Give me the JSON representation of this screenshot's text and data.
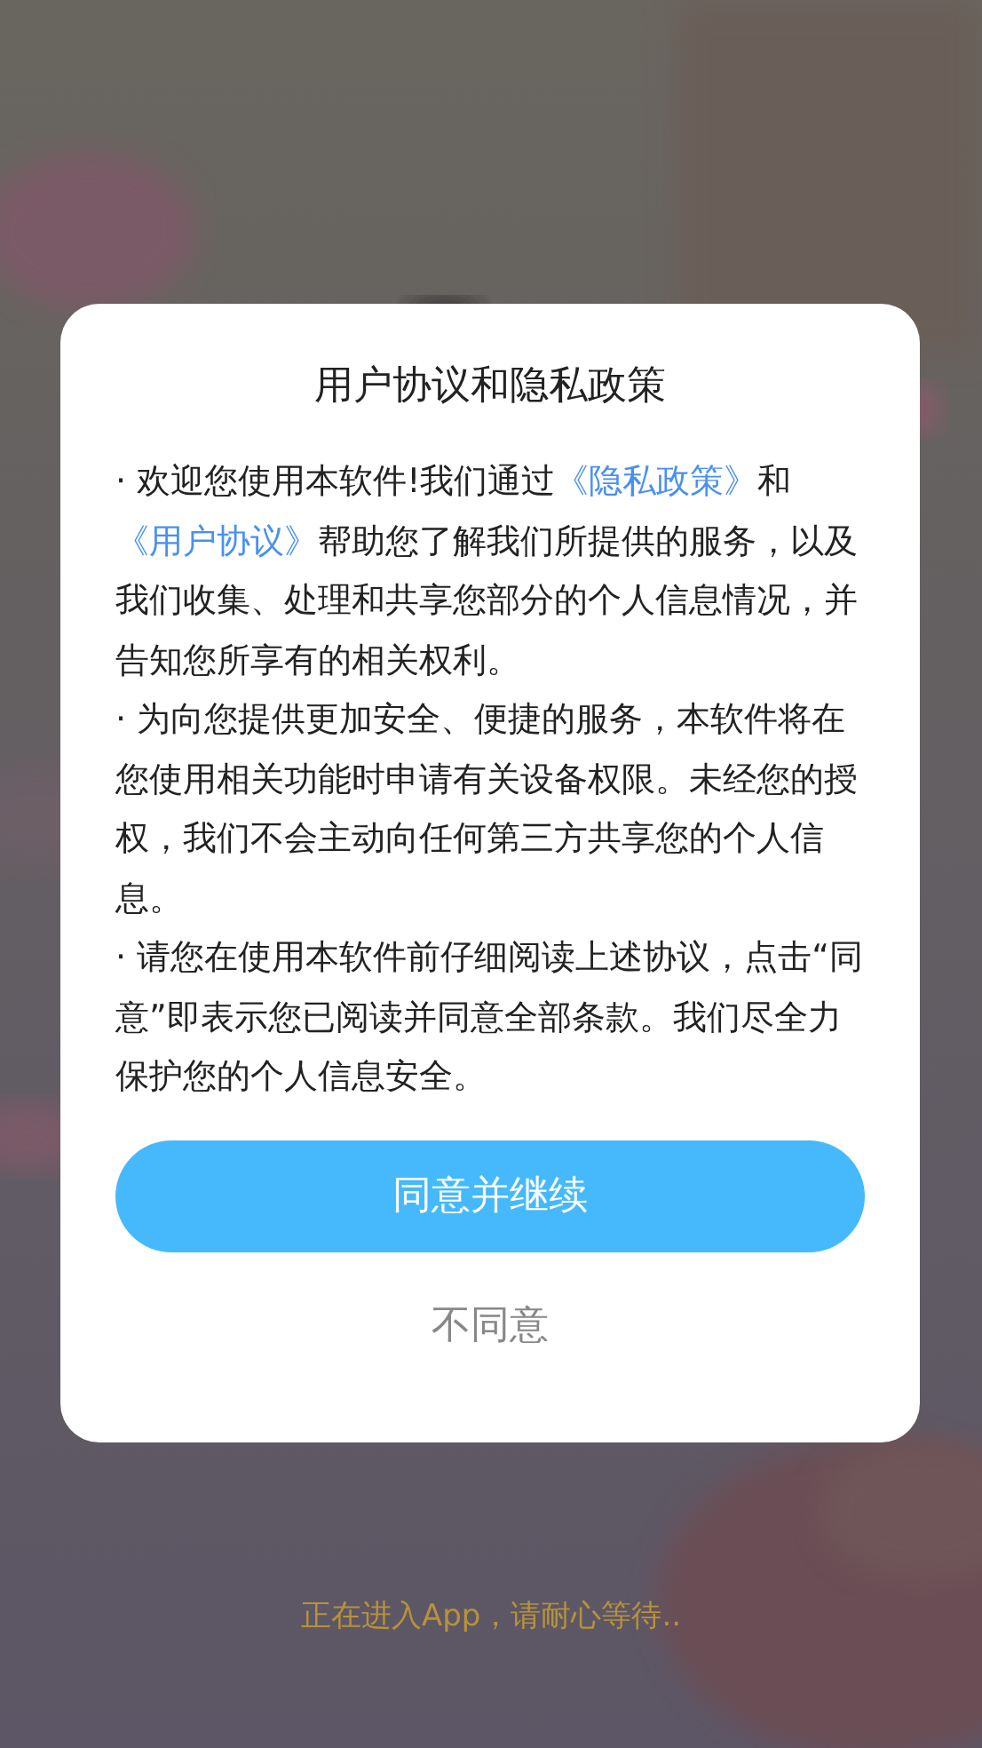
{
  "loading_text": "正在进入App，请耐心等待..",
  "dialog": {
    "title": "用户协议和隐私政策",
    "paragraphs": [
      [
        {
          "kind": "text",
          "text": "· 欢迎您使用本软件!我们通过"
        },
        {
          "kind": "link",
          "text": "《隐私政策》"
        },
        {
          "kind": "text",
          "text": "和"
        },
        {
          "kind": "link",
          "text": "《用户协议》"
        },
        {
          "kind": "text",
          "text": "帮助您了解我们所提供的服务，以及我们收集、处理和共享您部分的个人信息情况，并告知您所享有的相关权利。"
        }
      ],
      [
        {
          "kind": "text",
          "text": "· 为向您提供更加安全、便捷的服务，本软件将在您使用相关功能时申请有关设备权限。未经您的授权，我们不会主动向任何第三方共享您的个人信息。"
        }
      ],
      [
        {
          "kind": "text",
          "text": "· 请您在使用本软件前仔细阅读上述协议，点击“同意”即表示您已阅读并同意全部条款。我们尽全力保护您的个人信息安全。"
        }
      ]
    ],
    "buttons": [
      {
        "kind": "primary",
        "label": "同意并继续"
      },
      {
        "kind": "secondary",
        "label": "不同意"
      }
    ]
  }
}
